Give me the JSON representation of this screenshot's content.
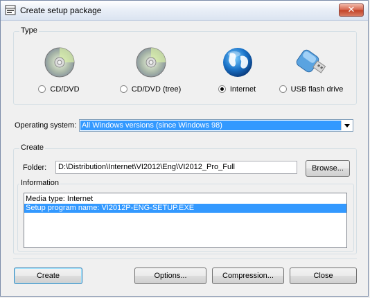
{
  "window": {
    "title": "Create setup package",
    "close_label": "✕"
  },
  "type_group": {
    "label": "Type",
    "options": [
      {
        "label": "CD/DVD",
        "icon": "cd-icon",
        "selected": false
      },
      {
        "label": "CD/DVD (tree)",
        "icon": "cd-icon",
        "selected": false
      },
      {
        "label": "Internet",
        "icon": "globe-icon",
        "selected": true
      },
      {
        "label": "USB flash drive",
        "icon": "usb-drive-icon",
        "selected": false
      }
    ]
  },
  "os": {
    "label": "Operating system:",
    "value": "All Windows versions (since Windows 98)"
  },
  "create_group": {
    "label": "Create",
    "folder_label": "Folder:",
    "folder_value": "D:\\Distribution\\Internet\\VI2012\\Eng\\VI2012_Pro_Full",
    "browse_label": "Browse..."
  },
  "info_group": {
    "label": "Information",
    "items": [
      {
        "text": "Media type: Internet",
        "selected": false
      },
      {
        "text": "Setup program name: VI2012P-ENG-SETUP.EXE",
        "selected": true
      }
    ]
  },
  "buttons": {
    "create": "Create",
    "options": "Options...",
    "compression": "Compression...",
    "close": "Close"
  },
  "colors": {
    "selection": "#3399ff",
    "group_border": "#d5dfe5",
    "window_bg": "#f0f0f0"
  }
}
